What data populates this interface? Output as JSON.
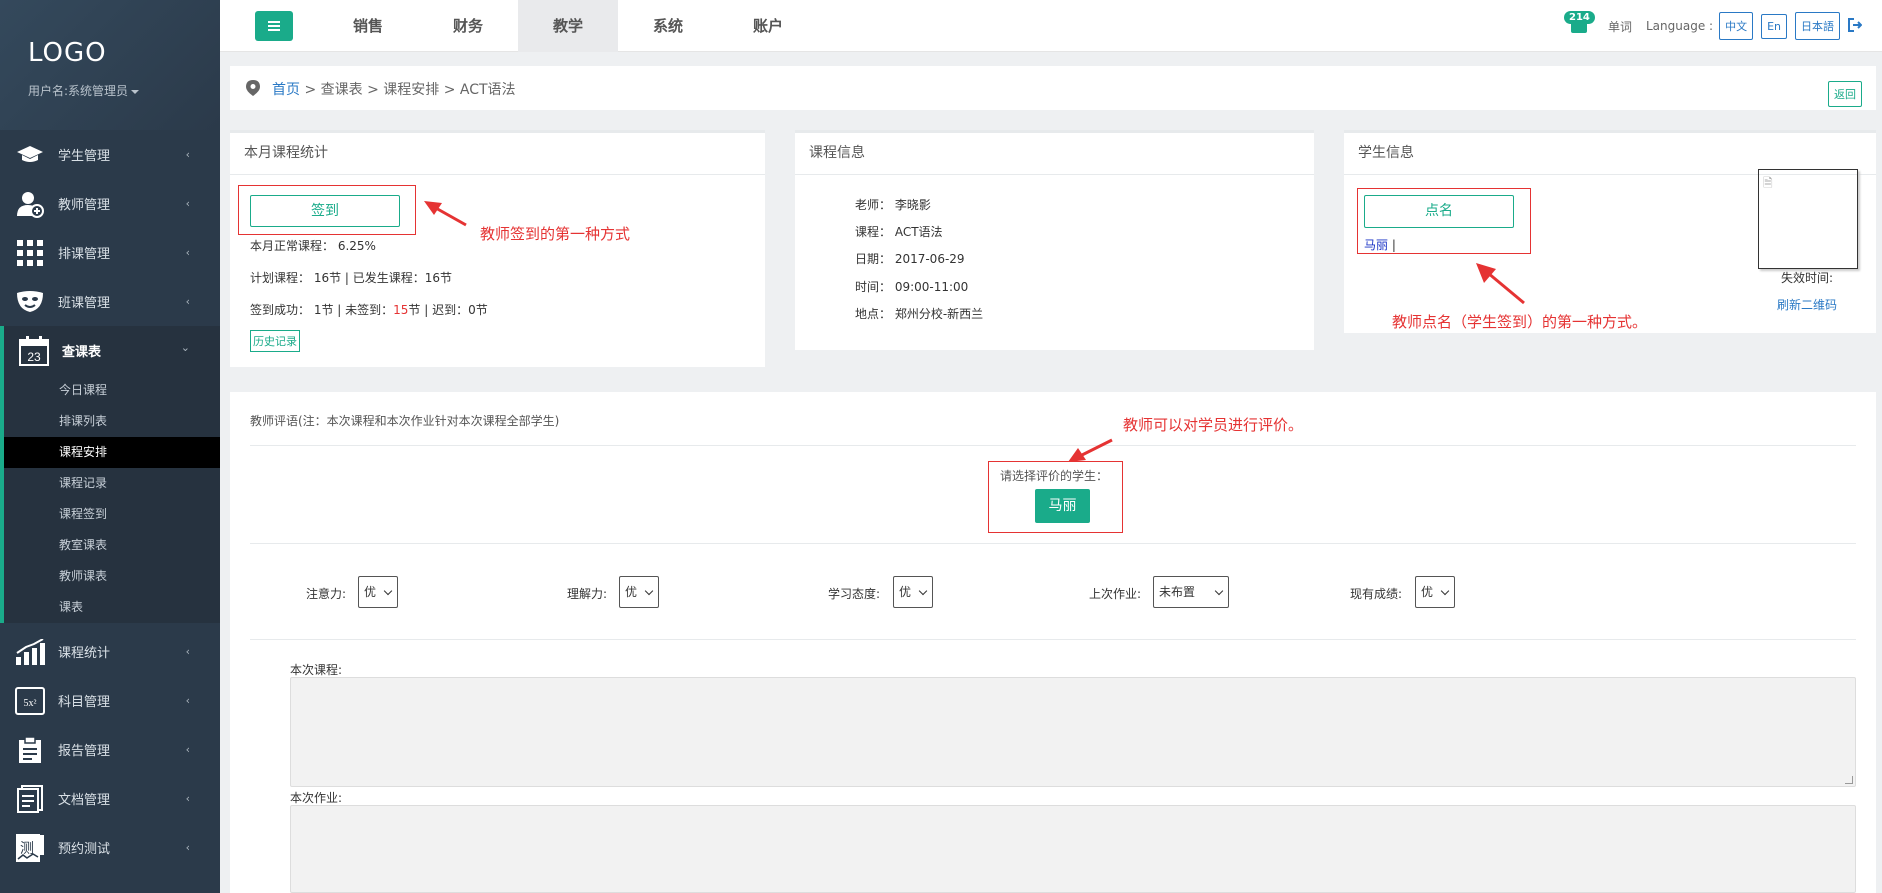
{
  "sidebar": {
    "logo": "LOGO",
    "user": "用户名:系统管理员",
    "items": [
      {
        "label": "学生管理"
      },
      {
        "label": "教师管理"
      },
      {
        "label": "排课管理"
      },
      {
        "label": "班课管理"
      },
      {
        "label": "查课表"
      },
      {
        "label": "课程统计"
      },
      {
        "label": "科目管理"
      },
      {
        "label": "报告管理"
      },
      {
        "label": "文档管理"
      },
      {
        "label": "预约测试"
      }
    ],
    "calendar_day": "23",
    "subitems": [
      "今日课程",
      "排课列表",
      "课程安排",
      "课程记录",
      "课程签到",
      "教室课表",
      "教师课表",
      "课表"
    ]
  },
  "topnav": {
    "tabs": [
      "销售",
      "财务",
      "教学",
      "系统",
      "账户"
    ],
    "badge": "214",
    "word": "单词",
    "language_label": "Language :",
    "langs": [
      "中文",
      "En",
      "日本語"
    ]
  },
  "breadcrumb": {
    "home": "首页",
    "rest": " > 查课表 > 课程安排 > ACT语法",
    "back": "返回"
  },
  "stats_panel": {
    "title": "本月课程统计",
    "signin": "签到",
    "normal": "本月正常课程：  6.25%",
    "planned": "计划课程：         16节 | 已发生课程：16节",
    "success_pre": "签到成功：         1节 |  未签到：",
    "unsigned_count": "15",
    "success_post": "节  |  迟到：0节",
    "history": "历史记录",
    "anno": "教师签到的第一种方式"
  },
  "course_panel": {
    "title": "课程信息",
    "teacher": "老师： 李晓影",
    "course": "课程： ACT语法",
    "date": "日期： 2017-06-29",
    "time": "时间： 09:00-11:00",
    "place": "地点： 郑州分校-新西兰"
  },
  "student_panel": {
    "title": "学生信息",
    "rollcall": "点名",
    "student": "马丽",
    "sep": " |",
    "expire": "失效时间:",
    "refresh": "刷新二维码",
    "anno": "教师点名（学生签到）的第一种方式。"
  },
  "evaluation": {
    "title": "教师评语(注：本次课程和本次作业针对本次课程全部学生)",
    "anno": "教师可以对学员进行评价。",
    "choose": "请选择评价的学生：",
    "student_btn": "马丽",
    "fields": [
      {
        "label": "注意力:",
        "value": "优"
      },
      {
        "label": "理解力:",
        "value": "优"
      },
      {
        "label": "学习态度:",
        "value": "优"
      },
      {
        "label": "上次作业:",
        "value": "未布置"
      },
      {
        "label": "现有成绩:",
        "value": "优"
      }
    ],
    "course_label": "本次课程:",
    "homework_label": "本次作业:"
  },
  "colors": {
    "accent": "#1aab8a",
    "sidebar": "#2b3a4a",
    "link": "#2a79c5",
    "annotation": "#e53333"
  }
}
